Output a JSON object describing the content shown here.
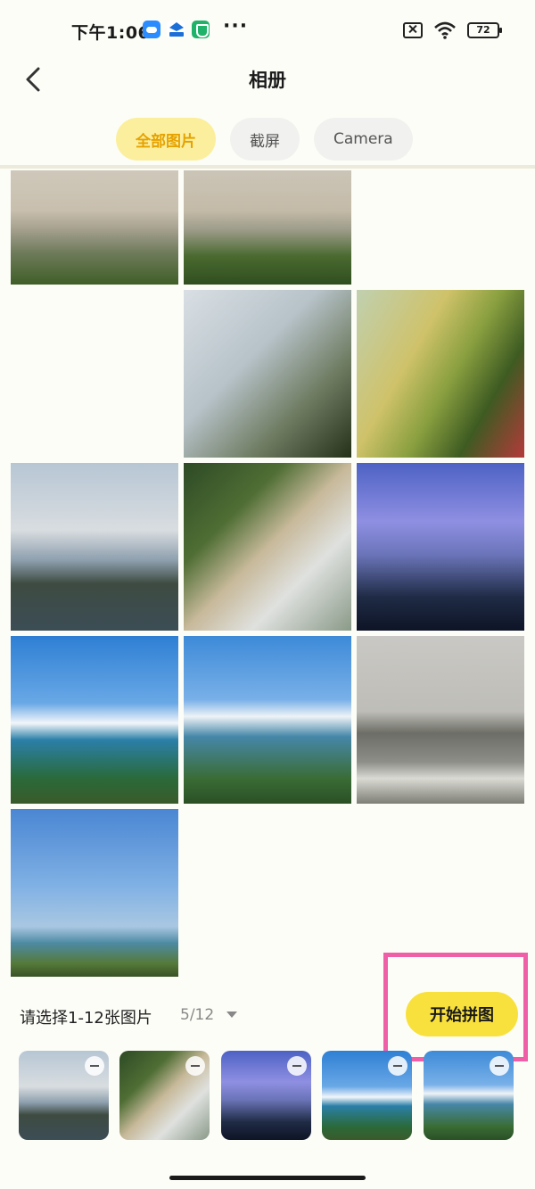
{
  "status_bar": {
    "time": "下午1:06",
    "more": "···",
    "battery": "72",
    "icons": [
      "cloud-app-icon",
      "cmbt-app-icon",
      "shield-app-icon",
      "sim-off-icon",
      "wifi-icon",
      "battery-icon"
    ]
  },
  "header": {
    "title": "相册",
    "back_icon": "chevron-left-icon"
  },
  "tabs": [
    {
      "label": "全部图片",
      "active": true
    },
    {
      "label": "截屏",
      "active": false
    },
    {
      "label": "Camera",
      "active": false
    }
  ],
  "photos": [
    {
      "name": "city-view-1"
    },
    {
      "name": "city-view-2"
    },
    {
      "name": "tree-branches"
    },
    {
      "name": "garden-path"
    },
    {
      "name": "lakeside-building"
    },
    {
      "name": "misty-waterfall"
    },
    {
      "name": "tower-at-dusk"
    },
    {
      "name": "coastline-1"
    },
    {
      "name": "coastline-2"
    },
    {
      "name": "beach-waves"
    },
    {
      "name": "coast-sky"
    }
  ],
  "selection": {
    "hint": "请选择1-12张图片",
    "count": "5/12",
    "start_button": "开始拼图",
    "selected_count": 5,
    "max": 12
  },
  "colors": {
    "accent_yellow": "#f8e13c",
    "active_tab_bg": "#fbef9e",
    "active_tab_text": "#e6a200",
    "highlight_pink": "#ef5fa7",
    "background": "#fdfdf8"
  }
}
